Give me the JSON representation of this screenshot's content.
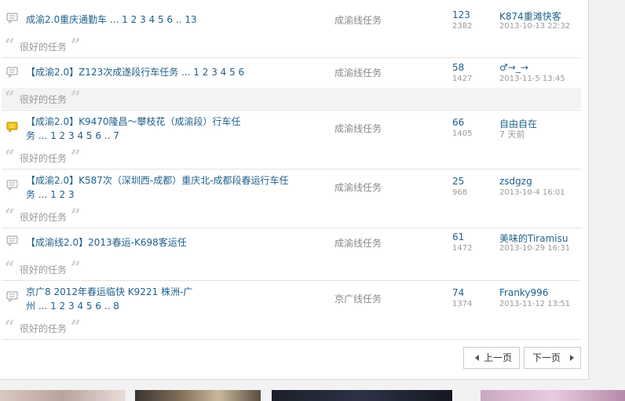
{
  "threads": [
    {
      "title": "成渝2.0重庆通勤车",
      "pages": "... 1 2 3 4 5 6 .. 13",
      "forum": "成渝线任务",
      "replies": "123",
      "views": "2382",
      "author": "K874重滩快客",
      "date": "2013-10-13 22:32",
      "summary": "很好的任务",
      "icon": "comment-icon"
    },
    {
      "title": "【成渝2.0】Z123次成遂段行车任务",
      "pages": "... 1 2 3 4 5 6",
      "forum": "成渝线任务",
      "replies": "58",
      "views": "1427",
      "author": "♂→_→",
      "date": "2013-11-5 13:45",
      "summary": "很好的任务",
      "icon": "comment-icon"
    },
    {
      "title": "【成渝2.0】K9470隆昌～攀枝花（成渝段）行车任务",
      "pages": "... 1 2 3 4 5 6 .. 7",
      "forum": "成渝线任务",
      "replies": "66",
      "views": "1405",
      "author": "自由自在",
      "date": "7 天前",
      "summary": "很好的任务",
      "icon": "new-comment-icon"
    },
    {
      "title": "【成渝2.0】K587次（深圳西-成都）重庆北-成都段春运行车任务",
      "pages": "... 1 2 3",
      "forum": "成渝线任务",
      "replies": "25",
      "views": "968",
      "author": "zsdgzg",
      "date": "2013-10-4 16:01",
      "summary": "很好的任务",
      "icon": "comment-icon"
    },
    {
      "title": "【成渝线2.0】2013春运-K698客运任",
      "pages": "",
      "forum": "成渝线任务",
      "replies": "61",
      "views": "1472",
      "author": "美味的Tiramisu",
      "date": "2013-10-29 16:31",
      "summary": "很好的任务",
      "icon": "comment-icon"
    },
    {
      "title": "京广8 2012年春运临快 K9221 株洲-广州",
      "pages": "... 1 2 3 4 5 6 .. 8",
      "forum": "京广线任务",
      "replies": "74",
      "views": "1374",
      "author": "Franky996",
      "date": "2013-11-12 13:51",
      "summary": "很好的任务",
      "icon": "comment-icon"
    }
  ],
  "pager": {
    "prev_label": "上一页",
    "next_label": "下一页",
    "prev_icon": "triangle-left-icon",
    "next_icon": "triangle-right-icon"
  },
  "colors": {
    "link": "#1f5f8b",
    "muted": "#999999",
    "icon_new": "#f2c200"
  }
}
